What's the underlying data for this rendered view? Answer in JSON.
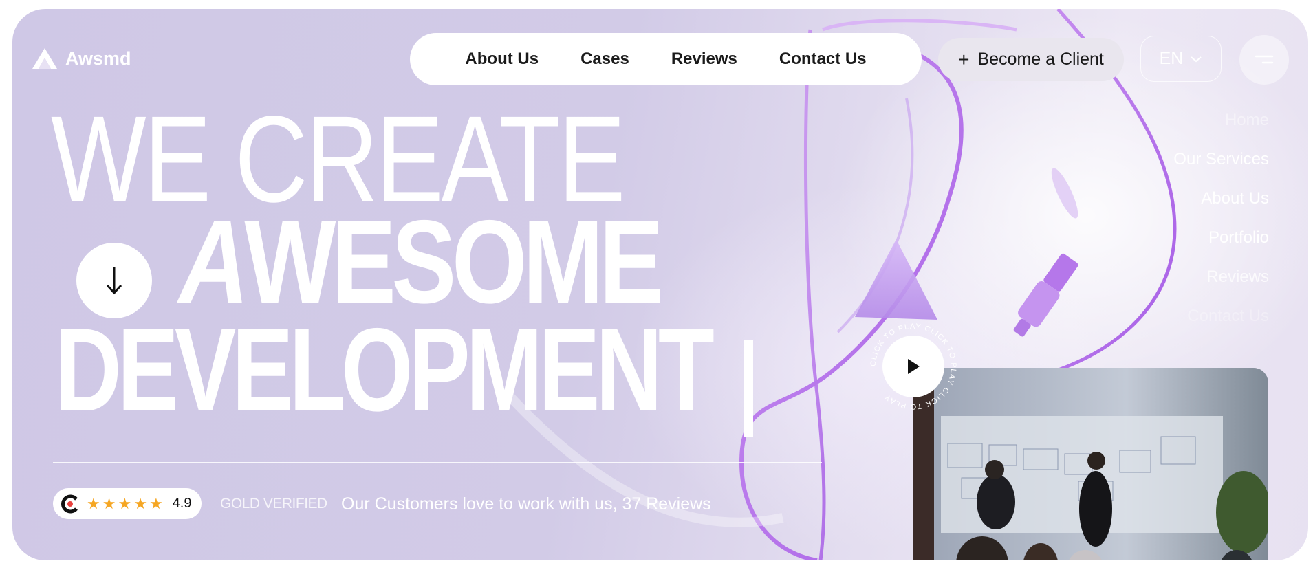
{
  "brand": {
    "name": "Awsmd"
  },
  "nav": {
    "links": [
      "About Us",
      "Cases",
      "Reviews",
      "Contact Us"
    ],
    "cta_label": "Become a Client",
    "cta_icon": "plus-icon",
    "language": "EN",
    "language_icon": "chevron-down-icon",
    "menu_icon": "menu-icon"
  },
  "side_menu": {
    "items": [
      "Home",
      "Our Services",
      "About Us",
      "Portfolio",
      "Reviews",
      "Contact Us"
    ]
  },
  "hero": {
    "line1": "WE CREATE",
    "line2_first": "A",
    "line2_rest": "WESOME",
    "line3": "DEVELOPMENT",
    "scroll_icon": "arrow-down-icon"
  },
  "rating": {
    "score": "4.9",
    "stars": 5,
    "badge": "GOLD VERIFIED",
    "text": "Our Customers love to work with us, 37 Reviews"
  },
  "video": {
    "play_label": "CLICK TO PLAY CLICK TO PLAY CLICK TO PLAY",
    "play_icon": "play-icon"
  },
  "colors": {
    "background": "#d2cbe7",
    "accent_purple": "#b06ae8",
    "star": "#f5a623",
    "text_dark": "#1a1a1a"
  }
}
